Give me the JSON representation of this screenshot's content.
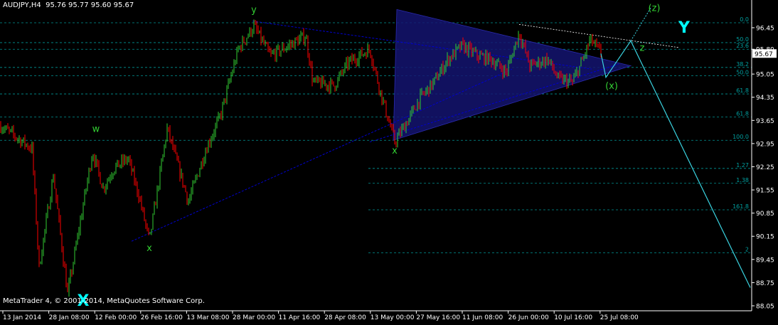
{
  "header": {
    "symbol": "AUDJPY,H4",
    "ohlc": "95.76 95.77 95.60 95.67"
  },
  "footer": {
    "copyright": "MetaTrader 4, © 2001-2014, MetaQuotes Software Corp."
  },
  "colors": {
    "background": "#000000",
    "bull": "#32cd32",
    "bear": "#ff0000",
    "axis": "#ffffff",
    "fibo": "#00c8c8",
    "wave_label": "#32cd32",
    "cycle_label": "#00ffff",
    "triangle": "#141470",
    "trend": "#0000d0"
  },
  "chart_data": {
    "type": "candlestick",
    "symbol": "AUDJPY",
    "timeframe": "H4",
    "last_price": 95.67,
    "ylim": [
      88.05,
      96.75
    ],
    "y_ticks": [
      "96.45",
      "95.80",
      "95.05",
      "94.35",
      "93.65",
      "92.95",
      "92.25",
      "91.55",
      "90.85",
      "90.15",
      "89.45",
      "88.75",
      "88.05"
    ],
    "x_ticks": [
      "13 Jan 2014",
      "28 Jan 08:00",
      "12 Feb 00:00",
      "26 Feb 16:00",
      "13 Mar 08:00",
      "28 Mar 00:00",
      "11 Apr 16:00",
      "28 Apr 08:00",
      "13 May 00:00",
      "27 May 16:00",
      "11 Jun 08:00",
      "26 Jun 00:00",
      "10 Jul 16:00",
      "25 Jul 08:00"
    ],
    "price_path": [
      [
        0,
        93.5
      ],
      [
        45,
        92.8
      ],
      [
        55,
        89.2
      ],
      [
        75,
        92.0
      ],
      [
        95,
        88.4
      ],
      [
        130,
        92.7
      ],
      [
        145,
        91.6
      ],
      [
        160,
        92.2
      ],
      [
        180,
        92.5
      ],
      [
        195,
        91.4
      ],
      [
        210,
        90.0
      ],
      [
        235,
        93.4
      ],
      [
        250,
        92.3
      ],
      [
        265,
        91.2
      ],
      [
        290,
        92.8
      ],
      [
        310,
        93.8
      ],
      [
        335,
        95.8
      ],
      [
        357,
        96.5
      ],
      [
        380,
        95.6
      ],
      [
        405,
        95.9
      ],
      [
        430,
        96.2
      ],
      [
        440,
        94.8
      ],
      [
        470,
        94.7
      ],
      [
        490,
        95.4
      ],
      [
        520,
        95.8
      ],
      [
        535,
        94.5
      ],
      [
        555,
        93.0
      ],
      [
        575,
        93.7
      ],
      [
        590,
        94.3
      ],
      [
        610,
        94.8
      ],
      [
        630,
        95.5
      ],
      [
        650,
        95.9
      ],
      [
        672,
        95.6
      ],
      [
        690,
        95.5
      ],
      [
        712,
        95.1
      ],
      [
        730,
        96.3
      ],
      [
        745,
        95.3
      ],
      [
        770,
        95.5
      ],
      [
        785,
        94.9
      ],
      [
        805,
        94.8
      ],
      [
        820,
        95.5
      ],
      [
        830,
        96.1
      ],
      [
        845,
        95.67
      ]
    ],
    "fibo_levels": [
      {
        "label": "0.0",
        "price": 96.6
      },
      {
        "label": "50.0",
        "price": 96.0
      },
      {
        "label": "23.6",
        "price": 95.8
      },
      {
        "label": "38.2",
        "price": 95.25
      },
      {
        "label": "50.0",
        "price": 95.0
      },
      {
        "label": "61.8",
        "price": 94.45
      },
      {
        "label": "61.8",
        "price": 93.75
      },
      {
        "label": "100.0",
        "price": 93.05
      },
      {
        "label": "1.27",
        "price": 92.2
      },
      {
        "label": "1.38",
        "price": 91.75
      },
      {
        "label": "161.8",
        "price": 90.95
      },
      {
        "label": "2",
        "price": 89.65
      }
    ],
    "wave_labels": [
      {
        "text": "y",
        "x_index": 357,
        "price": 96.9,
        "color": "wave_label"
      },
      {
        "text": "w",
        "x_index": 135,
        "price": 93.3,
        "color": "wave_label"
      },
      {
        "text": "x",
        "x_index": 210,
        "price": 89.7,
        "color": "wave_label"
      },
      {
        "text": "x",
        "x_index": 555,
        "price": 92.65,
        "color": "wave_label"
      },
      {
        "text": "(x)",
        "x_index": 860,
        "price": 94.6,
        "color": "wave_label"
      },
      {
        "text": "z",
        "x_index": 903,
        "price": 95.75,
        "color": "wave_label"
      },
      {
        "text": "(z)",
        "x_index": 920,
        "price": 96.95,
        "color": "wave_label"
      },
      {
        "text": "Y",
        "x_index": 962,
        "price": 96.3,
        "color": "cycle_label"
      },
      {
        "text": "X",
        "x_index": 117,
        "price": 88.05,
        "color": "cycle_label"
      }
    ],
    "projection": [
      [
        845,
        95.67
      ],
      [
        852,
        94.95
      ],
      [
        887,
        96.05
      ],
      [
        1055,
        88.6
      ]
    ],
    "projection_dotted": [
      [
        887,
        96.05
      ],
      [
        915,
        97.05
      ]
    ],
    "triangle": [
      [
        558,
        97.0
      ],
      [
        887,
        95.3
      ],
      [
        553,
        93.05
      ]
    ],
    "trend_lines": [
      [
        [
          185,
          90.0
        ],
        [
          720,
          95.2
        ]
      ],
      [
        [
          355,
          96.65
        ],
        [
          832,
          95.2
        ]
      ],
      [
        [
          520,
          93.0
        ],
        [
          870,
          95.35
        ]
      ]
    ],
    "resistance_line": [
      [
        730,
        96.55
      ],
      [
        955,
        95.85
      ]
    ],
    "grid": false,
    "legend": "none"
  }
}
